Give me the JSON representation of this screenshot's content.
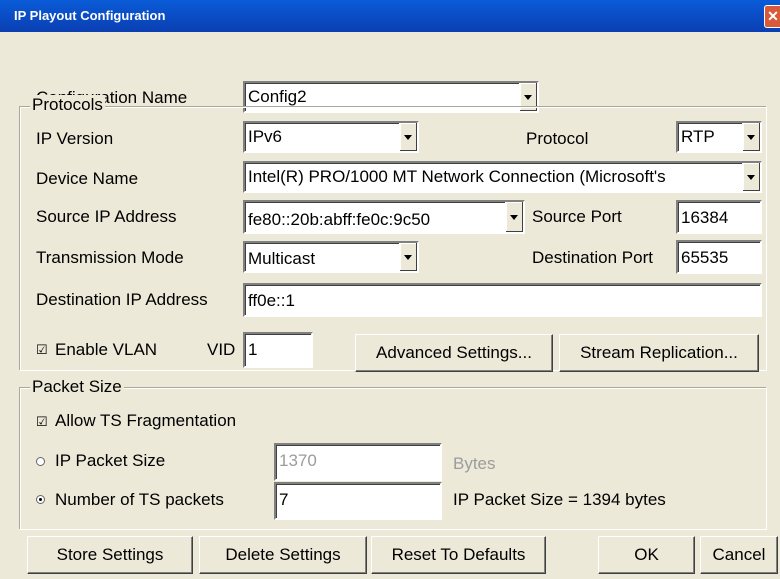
{
  "window": {
    "title": "IP Playout Configuration",
    "close_glyph": "✕"
  },
  "config": {
    "label": "Configuration Name",
    "value": "Config2"
  },
  "protocols": {
    "group_label": "Protocols",
    "ip_version_label": "IP Version",
    "ip_version_value": "IPv6",
    "protocol_label": "Protocol",
    "protocol_value": "RTP",
    "device_name_label": "Device Name",
    "device_name_value": "Intel(R) PRO/1000 MT Network Connection (Microsoft's",
    "source_ip_label": "Source IP Address",
    "source_ip_value": "fe80::20b:abff:fe0c:9c50",
    "source_port_label": "Source Port",
    "source_port_value": "16384",
    "transmission_mode_label": "Transmission Mode",
    "transmission_mode_value": "Multicast",
    "dest_port_label": "Destination Port",
    "dest_port_value": "65535",
    "dest_ip_label": "Destination IP Address",
    "dest_ip_value": "ff0e::1",
    "enable_vlan_label": "Enable VLAN",
    "enable_vlan_checked": true,
    "vid_label": "VID",
    "vid_value": "1",
    "advanced_button": "Advanced Settings...",
    "stream_replication_button": "Stream Replication..."
  },
  "packet_size": {
    "group_label": "Packet Size",
    "allow_fragmentation_label": "Allow TS Fragmentation",
    "allow_fragmentation_checked": true,
    "ip_packet_size_label": "IP Packet Size",
    "ip_packet_size_value": "1370",
    "bytes_label": "Bytes",
    "num_ts_label": "Number of TS packets",
    "num_ts_value": "7",
    "summary_text": "IP Packet Size =  1394 bytes",
    "selected_option": "Number of TS packets"
  },
  "footer": {
    "store_button": "Store Settings",
    "delete_button": "Delete Settings",
    "reset_button": "Reset To Defaults",
    "ok_button": "OK",
    "cancel_button": "Cancel"
  },
  "icons": {
    "check": "☑"
  }
}
